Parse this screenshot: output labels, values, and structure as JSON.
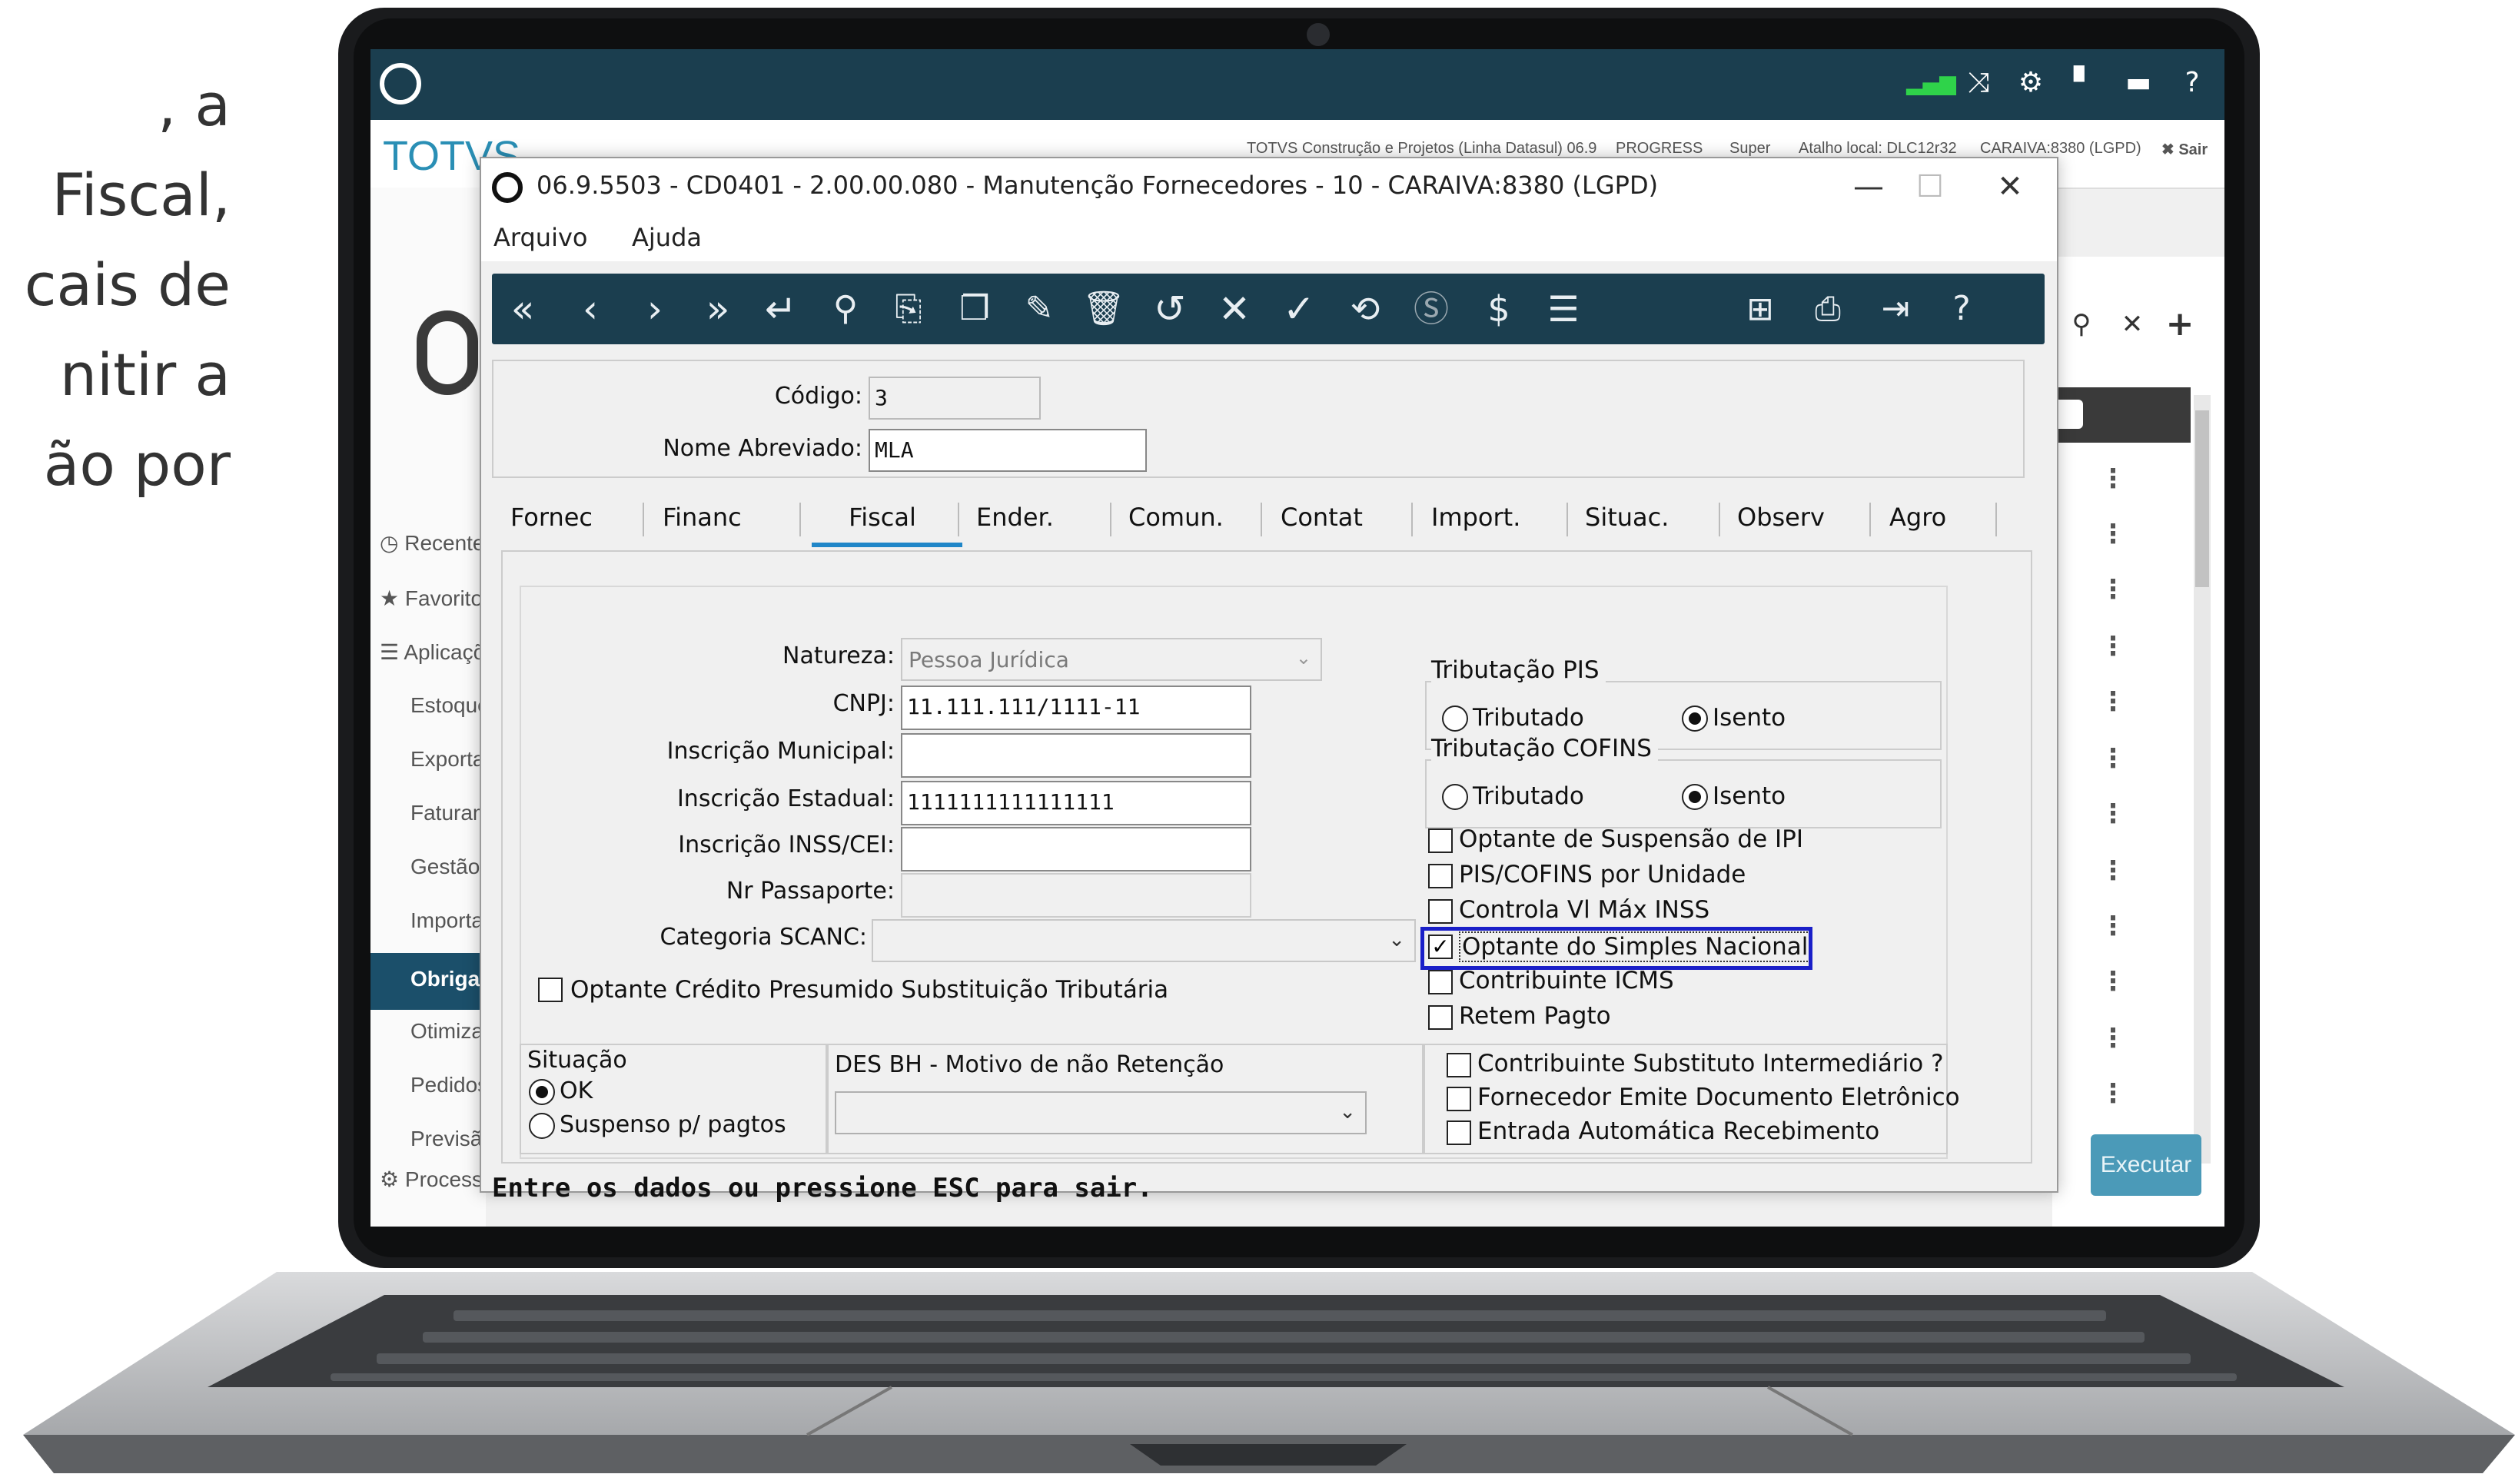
{
  "slide": {
    "lines": [
      ", a",
      "Fiscal,",
      "cais de",
      "nitir a",
      "ão por"
    ]
  },
  "app": {
    "brand": "TOTVS",
    "header_icons": [
      "signal-icon",
      "shuffle-icon",
      "gear-icon",
      "document-icon",
      "chat-icon",
      "help-icon"
    ],
    "top_info": {
      "company": "TOTVS Construção e Projetos (Linha Datasul) 06.9",
      "db": "PROGRESS",
      "user": "Super",
      "shortcut": "Atalho local: DLC12r32",
      "env": "CARAIVA:8380 (LGPD)",
      "exit": "✖ Sair"
    },
    "nav": {
      "recent": "Recente",
      "favorites": "Favorito",
      "apps": "Aplicaçõ",
      "items": [
        "Estoque",
        "Exporta",
        "Faturam",
        "Gestão",
        "Importa",
        "Obrigaç",
        "Otimiza",
        "Pedidos",
        "Previsã"
      ],
      "active": "Obrigaç",
      "process": "Process"
    },
    "execute_button": "Executar"
  },
  "dialog": {
    "title": "06.9.5503 - CD0401 - 2.00.00.080 - Manutenção Fornecedores - 10 - CARAIVA:8380 (LGPD)",
    "menu": [
      "Arquivo",
      "Ajuda"
    ],
    "codigo_label": "Código:",
    "codigo_value": "3",
    "nome_label": "Nome Abreviado:",
    "nome_value": "MLA",
    "tabs": [
      "Fornec",
      "Financ",
      "Fiscal",
      "Ender.",
      "Comun.",
      "Contat",
      "Import.",
      "Situac.",
      "Observ",
      "Agro"
    ],
    "active_tab": "Fiscal",
    "fiscal": {
      "natureza_label": "Natureza:",
      "natureza_value": "Pessoa Jurídica",
      "cnpj_label": "CNPJ:",
      "cnpj_value": "11.111.111/1111-11",
      "insc_municipal_label": "Inscrição Municipal:",
      "insc_municipal_value": "",
      "insc_estadual_label": "Inscrição Estadual:",
      "insc_estadual_value": "1111111111111111",
      "insc_inss_label": "Inscrição INSS/CEI:",
      "insc_inss_value": "",
      "passaporte_label": "Nr Passaporte:",
      "passaporte_value": "",
      "scanc_label": "Categoria SCANC:",
      "credito_presumido": "Optante Crédito Presumido Substituição Tributária",
      "pis_group": "Tributação PIS",
      "cofins_group": "Tributação COFINS",
      "tributado": "Tributado",
      "isento": "Isento",
      "checks": [
        {
          "label": "Optante de Suspensão de IPI",
          "checked": false
        },
        {
          "label": "PIS/COFINS por Unidade",
          "checked": false
        },
        {
          "label": "Controla Vl Máx INSS",
          "checked": false
        },
        {
          "label": "Optante do Simples Nacional",
          "checked": true
        },
        {
          "label": "Contribuinte ICMS",
          "checked": false
        },
        {
          "label": "Retem Pagto",
          "checked": false
        }
      ],
      "situacao_label": "Situação",
      "situacao_ok": "OK",
      "situacao_suspenso": "Suspenso p/ pagtos",
      "desbh_label": "DES BH - Motivo de não Retenção",
      "bottom_checks": [
        {
          "label": "Contribuinte Substituto Intermediário ?",
          "checked": false
        },
        {
          "label": "Fornecedor Emite Documento Eletrônico",
          "checked": false
        },
        {
          "label": "Entrada Automática Recebimento",
          "checked": false
        }
      ]
    },
    "status_text": "Entre os dados ou pressione ESC para sair."
  },
  "colors": {
    "header": "#1b3e4f",
    "toolbar": "#1b3e4f",
    "tab_underline": "#1f86c8",
    "highlight": "#1a1fc8",
    "execute": "#4b9ab8"
  }
}
